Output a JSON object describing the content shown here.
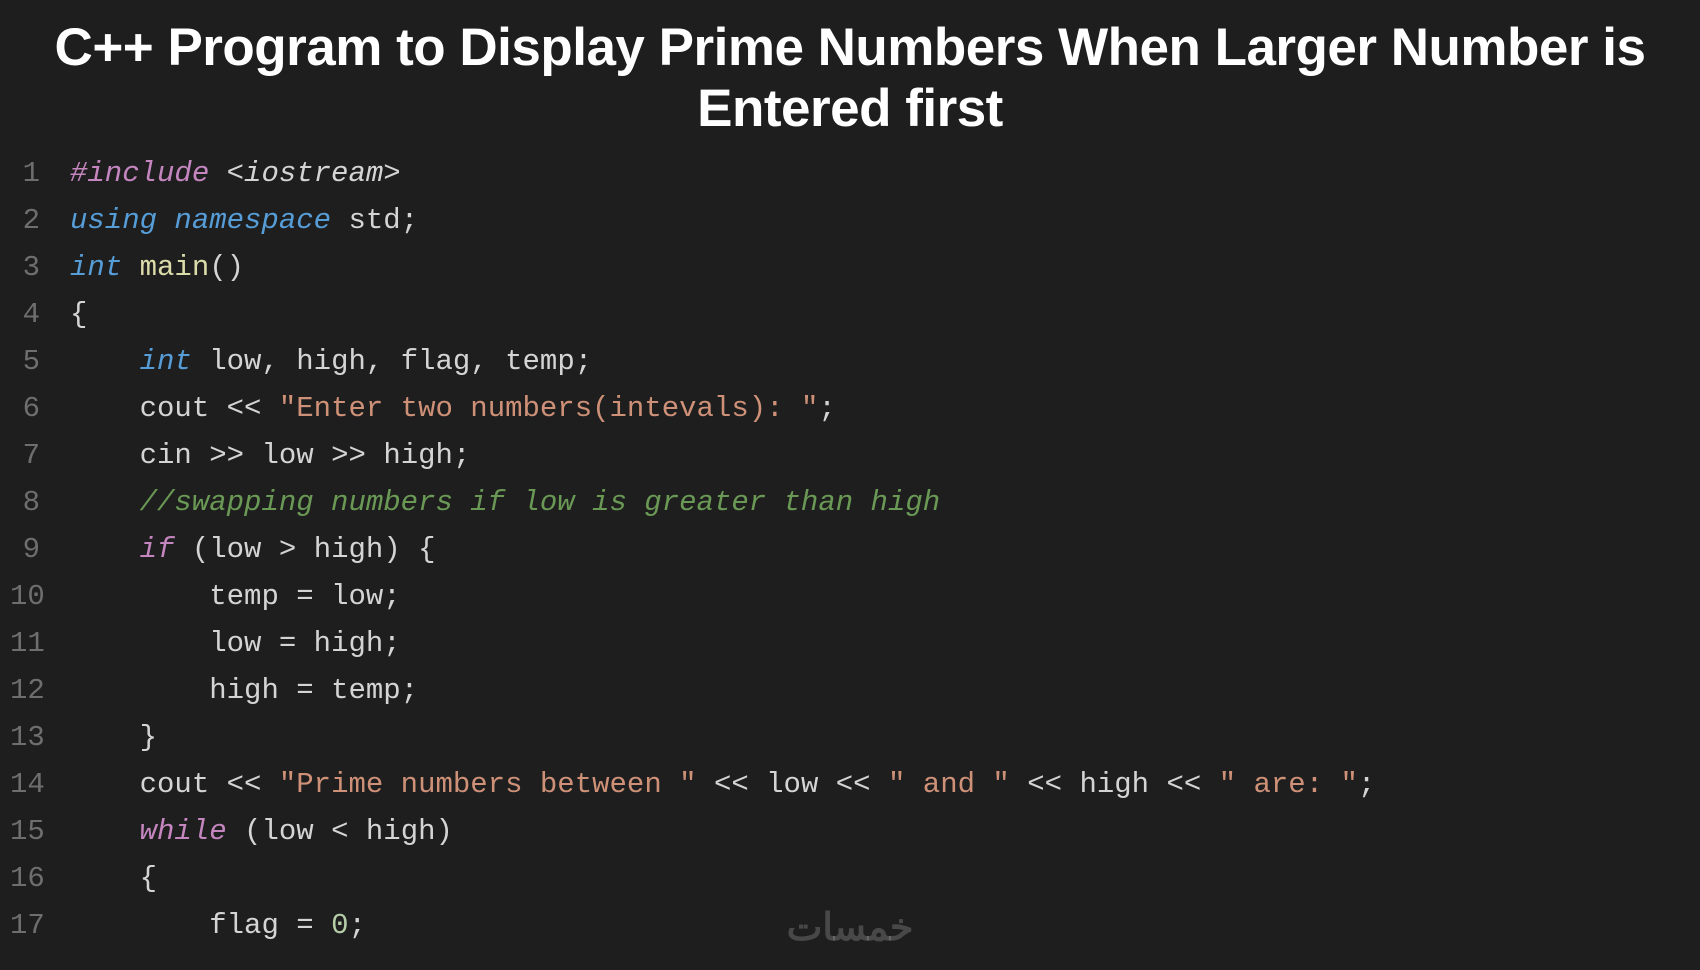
{
  "title": "C++ Program to Display Prime Numbers When Larger Number is Entered first",
  "watermark": "خمسات",
  "code": {
    "lines": [
      {
        "num": "1",
        "indent": 0,
        "tokens": [
          {
            "t": "preproc",
            "v": "#include"
          },
          {
            "t": "ident",
            "v": " "
          },
          {
            "t": "preproc-target",
            "v": "<iostream>"
          }
        ]
      },
      {
        "num": "2",
        "indent": 0,
        "tokens": [
          {
            "t": "keyword",
            "v": "using"
          },
          {
            "t": "ident",
            "v": " "
          },
          {
            "t": "keyword",
            "v": "namespace"
          },
          {
            "t": "ident",
            "v": " std"
          },
          {
            "t": "punct",
            "v": ";"
          }
        ]
      },
      {
        "num": "3",
        "indent": 0,
        "tokens": [
          {
            "t": "type",
            "v": "int"
          },
          {
            "t": "ident",
            "v": " "
          },
          {
            "t": "func",
            "v": "main"
          },
          {
            "t": "punct",
            "v": "()"
          }
        ]
      },
      {
        "num": "4",
        "indent": 0,
        "tokens": [
          {
            "t": "punct",
            "v": "{"
          }
        ]
      },
      {
        "num": "5",
        "indent": 1,
        "tokens": [
          {
            "t": "type",
            "v": "int"
          },
          {
            "t": "ident",
            "v": " low"
          },
          {
            "t": "punct",
            "v": ","
          },
          {
            "t": "ident",
            "v": " high"
          },
          {
            "t": "punct",
            "v": ","
          },
          {
            "t": "ident",
            "v": " flag"
          },
          {
            "t": "punct",
            "v": ","
          },
          {
            "t": "ident",
            "v": " temp"
          },
          {
            "t": "punct",
            "v": ";"
          }
        ]
      },
      {
        "num": "6",
        "indent": 1,
        "tokens": [
          {
            "t": "ident",
            "v": "cout "
          },
          {
            "t": "op",
            "v": "<< "
          },
          {
            "t": "string",
            "v": "\"Enter two numbers(intevals): \""
          },
          {
            "t": "punct",
            "v": ";"
          }
        ]
      },
      {
        "num": "7",
        "indent": 1,
        "tokens": [
          {
            "t": "ident",
            "v": "cin "
          },
          {
            "t": "op",
            "v": ">> "
          },
          {
            "t": "ident",
            "v": "low "
          },
          {
            "t": "op",
            "v": ">> "
          },
          {
            "t": "ident",
            "v": "high"
          },
          {
            "t": "punct",
            "v": ";"
          }
        ]
      },
      {
        "num": "8",
        "indent": 1,
        "tokens": [
          {
            "t": "comment",
            "v": "//swapping numbers if low is greater than high"
          }
        ]
      },
      {
        "num": "9",
        "indent": 1,
        "tokens": [
          {
            "t": "control",
            "v": "if"
          },
          {
            "t": "ident",
            "v": " "
          },
          {
            "t": "punct",
            "v": "("
          },
          {
            "t": "ident",
            "v": "low "
          },
          {
            "t": "op",
            "v": "> "
          },
          {
            "t": "ident",
            "v": "high"
          },
          {
            "t": "punct",
            "v": ")"
          },
          {
            "t": "ident",
            "v": " "
          },
          {
            "t": "punct",
            "v": "{"
          }
        ]
      },
      {
        "num": "10",
        "indent": 2,
        "tokens": [
          {
            "t": "ident",
            "v": "temp "
          },
          {
            "t": "op",
            "v": "= "
          },
          {
            "t": "ident",
            "v": "low"
          },
          {
            "t": "punct",
            "v": ";"
          }
        ]
      },
      {
        "num": "11",
        "indent": 2,
        "tokens": [
          {
            "t": "ident",
            "v": "low "
          },
          {
            "t": "op",
            "v": "= "
          },
          {
            "t": "ident",
            "v": "high"
          },
          {
            "t": "punct",
            "v": ";"
          }
        ]
      },
      {
        "num": "12",
        "indent": 2,
        "tokens": [
          {
            "t": "ident",
            "v": "high "
          },
          {
            "t": "op",
            "v": "= "
          },
          {
            "t": "ident",
            "v": "temp"
          },
          {
            "t": "punct",
            "v": ";"
          }
        ]
      },
      {
        "num": "13",
        "indent": 1,
        "tokens": [
          {
            "t": "punct",
            "v": "}"
          }
        ]
      },
      {
        "num": "14",
        "indent": 1,
        "tokens": [
          {
            "t": "ident",
            "v": "cout "
          },
          {
            "t": "op",
            "v": "<< "
          },
          {
            "t": "string",
            "v": "\"Prime numbers between \""
          },
          {
            "t": "ident",
            "v": " "
          },
          {
            "t": "op",
            "v": "<< "
          },
          {
            "t": "ident",
            "v": "low "
          },
          {
            "t": "op",
            "v": "<< "
          },
          {
            "t": "string",
            "v": "\" and \""
          },
          {
            "t": "ident",
            "v": " "
          },
          {
            "t": "op",
            "v": "<< "
          },
          {
            "t": "ident",
            "v": "high "
          },
          {
            "t": "op",
            "v": "<< "
          },
          {
            "t": "string",
            "v": "\" are: \""
          },
          {
            "t": "punct",
            "v": ";"
          }
        ]
      },
      {
        "num": "15",
        "indent": 1,
        "tokens": [
          {
            "t": "control",
            "v": "while"
          },
          {
            "t": "ident",
            "v": " "
          },
          {
            "t": "punct",
            "v": "("
          },
          {
            "t": "ident",
            "v": "low "
          },
          {
            "t": "op",
            "v": "< "
          },
          {
            "t": "ident",
            "v": "high"
          },
          {
            "t": "punct",
            "v": ")"
          }
        ]
      },
      {
        "num": "16",
        "indent": 1,
        "tokens": [
          {
            "t": "punct",
            "v": "{"
          }
        ]
      },
      {
        "num": "17",
        "indent": 2,
        "tokens": [
          {
            "t": "ident",
            "v": "flag "
          },
          {
            "t": "op",
            "v": "= "
          },
          {
            "t": "number",
            "v": "0"
          },
          {
            "t": "punct",
            "v": ";"
          }
        ]
      }
    ]
  }
}
